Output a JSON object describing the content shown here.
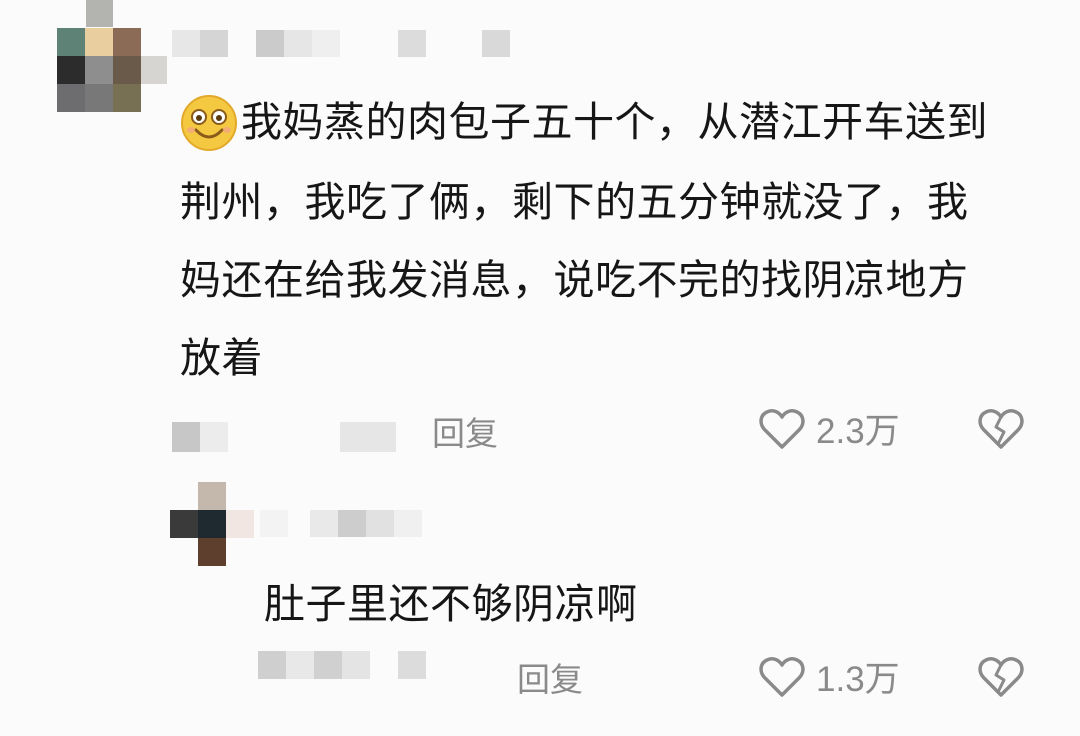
{
  "comments": [
    {
      "text_lines": [
        "我妈蒸的肉包子五十个，从潜江开车送到",
        "荆州，我吃了俩，剩下的五分钟就没了，我",
        "妈还在给我发消息，说吃不完的找阴凉地方",
        "放着"
      ],
      "reply_label": "回复",
      "like_count": "2.3万"
    },
    {
      "text_lines": [
        "肚子里还不够阴凉啊"
      ],
      "reply_label": "回复",
      "like_count": "1.3万"
    }
  ],
  "icons": {
    "emoji": "smiley-face-icon",
    "like": "heart-outline-icon",
    "dislike": "broken-heart-icon"
  },
  "colors": {
    "text": "#161616",
    "meta": "#8a8a8a",
    "emoji": "#f5c842"
  }
}
